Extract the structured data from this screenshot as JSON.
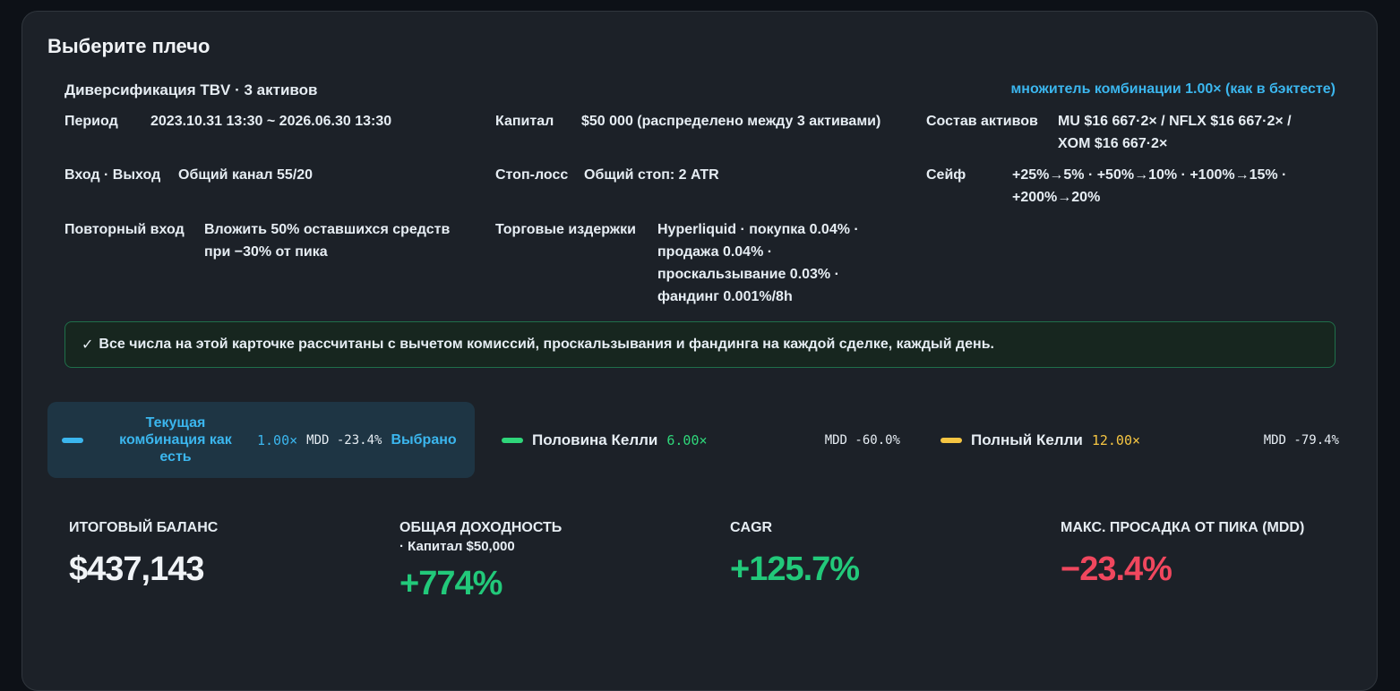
{
  "card": {
    "title": "Выберите плечо",
    "strategy": "Диверсификация TBV · 3 активов",
    "multiplier_note": "множитель комбинации 1.00× (как в бэктесте)"
  },
  "params": {
    "period": {
      "label": "Период",
      "value": "2023.10.31 13:30 ~ 2026.06.30 13:30"
    },
    "capital": {
      "label": "Капитал",
      "value": "$50 000 (распределено между 3 активами)"
    },
    "composition": {
      "label": "Состав активов",
      "line1": "MU $16 667·2× / NFLX $16 667·2× /",
      "line2": "XOM $16 667·2×"
    },
    "entry_exit": {
      "label": "Вход · Выход",
      "value": "Общий канал 55/20"
    },
    "stop_loss": {
      "label": "Стоп-лосс",
      "value": "Общий стоп: 2 ATR"
    },
    "safe": {
      "label": "Сейф",
      "line1": "+25%→5% · +50%→10% · +100%→15% ·",
      "line2": "+200%→20%"
    },
    "reentry": {
      "label": "Повторный вход",
      "line1": "Вложить 50% оставшихся средств",
      "line2": "при −30% от пика"
    },
    "costs": {
      "label": "Торговые издержки",
      "line1": "Hyperliquid · покупка 0.04% ·",
      "line2": "продажа 0.04% ·",
      "line3": "проскальзывание 0.03% ·",
      "line4": "фандинг 0.001%/8h"
    }
  },
  "notice": {
    "check": "✓",
    "text": "Все числа на этой карточке рассчитаны с вычетом комиссий, проскальзывания и фандинга на каждой сделке, каждый день."
  },
  "leverage_options": [
    {
      "name_line1": "Текущая",
      "name_line2": "комбинация как",
      "name_line3": "есть",
      "multiplier": "1.00×",
      "mdd": "MDD -23.4%",
      "status": "Выбрано",
      "color": "#3bb6ee",
      "selected": true
    },
    {
      "name": "Половина Келли",
      "multiplier": "6.00×",
      "mdd": "MDD -60.0%",
      "color": "#2fd67a",
      "selected": false
    },
    {
      "name": "Полный Келли",
      "multiplier": "12.00×",
      "mdd": "MDD -79.4%",
      "color": "#f5c542",
      "selected": false
    }
  ],
  "stats": {
    "final_balance": {
      "label": "ИТОГОВЫЙ БАЛАНС",
      "value": "$437,143",
      "color": "#f0f3f6"
    },
    "total_return": {
      "label": "ОБЩАЯ ДОХОДНОСТЬ",
      "sub": "· Капитал $50,000",
      "value": "+774%",
      "color": "#22c97a"
    },
    "cagr": {
      "label": "CAGR",
      "value": "+125.7%",
      "color": "#22c97a"
    },
    "mdd": {
      "label": "МАКС. ПРОСАДКА ОТ ПИКА (MDD)",
      "value": "−23.4%",
      "color": "#f0475e"
    }
  }
}
